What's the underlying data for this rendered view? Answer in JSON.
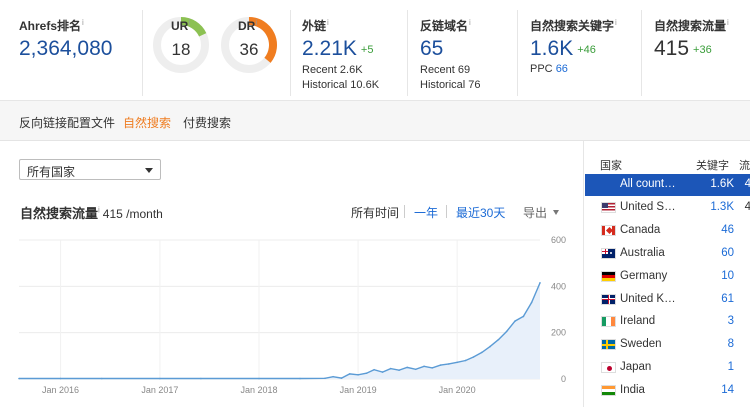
{
  "metrics": {
    "ahrefs_rank": {
      "label": "Ahrefs排名",
      "info": "i",
      "value": "2,364,080"
    },
    "ur": {
      "label": "UR",
      "info": "i",
      "value": "18",
      "score": 18
    },
    "dr": {
      "label": "DR",
      "info": "i",
      "value": "36",
      "score": 36
    },
    "backlinks": {
      "label": "外链",
      "info": "i",
      "value": "2.21K",
      "delta": "+5",
      "recent": "Recent 2.6K",
      "historical": "Historical 10.6K"
    },
    "ref_domains": {
      "label": "反链域名",
      "info": "i",
      "value": "65",
      "recent": "Recent 69",
      "historical": "Historical 76"
    },
    "organic_keywords": {
      "label": "自然搜索关键字",
      "info": "i",
      "value": "1.6K",
      "delta": "+46",
      "ppc_label": "PPC",
      "ppc_value": "66"
    },
    "organic_traffic": {
      "label": "自然搜索流量",
      "info": "i",
      "value": "415",
      "delta": "+36"
    }
  },
  "tabs": [
    {
      "label": "反向链接配置文件",
      "active": false
    },
    {
      "label": "自然搜索",
      "active": true
    },
    {
      "label": "付费搜索",
      "active": false
    }
  ],
  "country_select": {
    "value": "所有国家"
  },
  "chart_header": {
    "title": "自然搜索流量",
    "info": "i",
    "subtitle": "415 /month"
  },
  "controls": {
    "all_time": "所有时间",
    "one_year": "一年",
    "last30": "最近30天",
    "export": "导出"
  },
  "colors": {
    "accent": "#ef7d22",
    "link": "#1c6bd6",
    "ur_arc": "#8cc152",
    "dr_arc": "#f07d20",
    "line": "#5b9bd5",
    "selected_row": "#1c56b8",
    "delta_green": "#3a9d3a"
  },
  "chart_data": {
    "type": "area",
    "title": "自然搜索流量",
    "x_tick_labels": [
      "Jan 2016",
      "Jan 2017",
      "Jan 2018",
      "Jan 2019",
      "Jan 2020"
    ],
    "y_tick_labels": [
      "600",
      "400",
      "200",
      "0"
    ],
    "ylim": [
      0,
      600
    ],
    "grid": true,
    "series": [
      {
        "x": [
          "2015-08",
          "2016-01",
          "2016-06",
          "2017-01",
          "2017-06",
          "2018-01",
          "2018-06",
          "2018-09",
          "2018-10",
          "2018-11",
          "2018-12",
          "2019-01",
          "2019-02",
          "2019-03",
          "2019-04",
          "2019-05",
          "2019-06",
          "2019-07",
          "2019-08",
          "2019-09",
          "2019-10",
          "2019-11",
          "2019-12",
          "2020-01",
          "2020-02",
          "2020-03",
          "2020-04",
          "2020-05",
          "2020-06",
          "2020-07",
          "2020-08",
          "2020-09",
          "2020-10",
          "2020-11"
        ],
        "values": [
          2,
          2,
          2,
          2,
          2,
          2,
          2,
          3,
          10,
          4,
          22,
          18,
          25,
          40,
          30,
          45,
          38,
          50,
          42,
          55,
          48,
          60,
          65,
          72,
          80,
          95,
          115,
          140,
          170,
          205,
          250,
          270,
          330,
          415
        ]
      }
    ]
  },
  "country_table": {
    "headers": {
      "country": "国家",
      "keywords": "关键字",
      "traffic": "流"
    },
    "rows": [
      {
        "flag": "globe-icon",
        "name": "All count…",
        "keywords": "1.6K",
        "extra": "4",
        "selected": true
      },
      {
        "flag": "us-flag-icon",
        "name": "United S…",
        "keywords": "1.3K",
        "extra": "4",
        "selected": false
      },
      {
        "flag": "canada-flag-icon",
        "name": "Canada",
        "keywords": "46",
        "extra": "",
        "selected": false
      },
      {
        "flag": "australia-flag-icon",
        "name": "Australia",
        "keywords": "60",
        "extra": "",
        "selected": false
      },
      {
        "flag": "germany-flag-icon",
        "name": "Germany",
        "keywords": "10",
        "extra": "",
        "selected": false
      },
      {
        "flag": "uk-flag-icon",
        "name": "United K…",
        "keywords": "61",
        "extra": "",
        "selected": false
      },
      {
        "flag": "ireland-flag-icon",
        "name": "Ireland",
        "keywords": "3",
        "extra": "",
        "selected": false
      },
      {
        "flag": "sweden-flag-icon",
        "name": "Sweden",
        "keywords": "8",
        "extra": "",
        "selected": false
      },
      {
        "flag": "japan-flag-icon",
        "name": "Japan",
        "keywords": "1",
        "extra": "",
        "selected": false
      },
      {
        "flag": "india-flag-icon",
        "name": "India",
        "keywords": "14",
        "extra": "",
        "selected": false
      }
    ]
  }
}
